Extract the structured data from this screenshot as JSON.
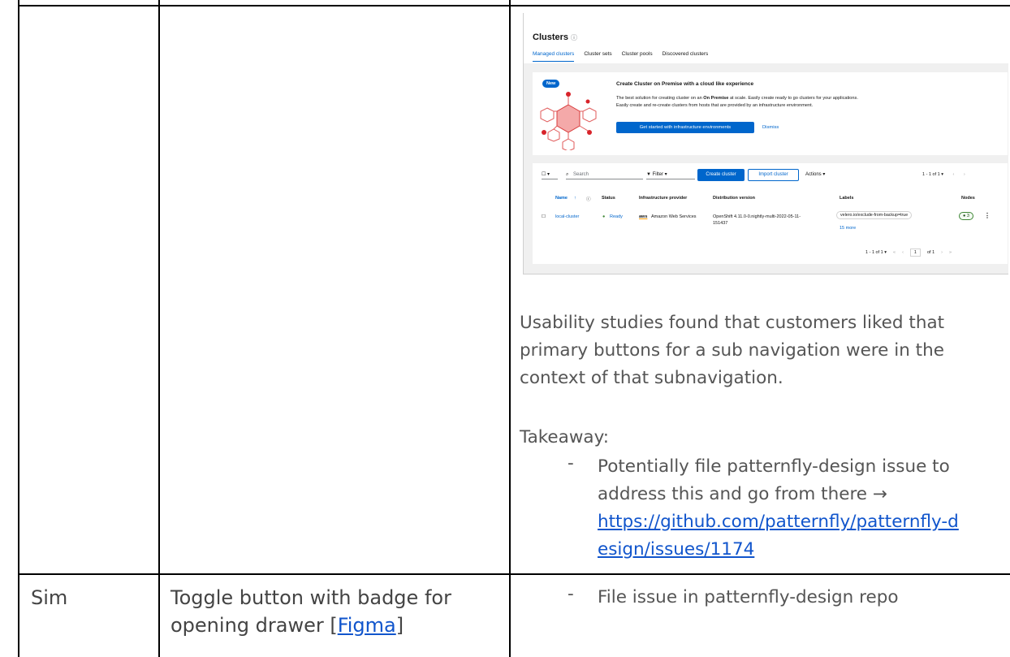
{
  "screenshot": {
    "title": "Clusters",
    "help_icon": "help-circle-icon",
    "tabs": [
      "Managed clusters",
      "Cluster sets",
      "Cluster pools",
      "Discovered clusters"
    ],
    "active_tab": "Managed clusters",
    "banner": {
      "badge": "New",
      "title": "Create Cluster on Premise with a cloud like experience",
      "desc_1": "The best solution for creating cluster on an",
      "desc_bold": "On Premise",
      "desc_2": "at scale. Easily create ready to go clusters for your applications.",
      "desc_3": "Easily create and re-create clusters from hosts that are provided by an infrastructure environment.",
      "button": "Get started with infrastructure environments",
      "dismiss": "Dismiss"
    },
    "toolbar": {
      "search_placeholder": "Search",
      "filter": "Filter",
      "create": "Create cluster",
      "import": "Import cluster",
      "actions": "Actions",
      "pagination": "1 - 1 of 1"
    },
    "columns": [
      "Name",
      "Status",
      "Infrastructure provider",
      "Distribution version",
      "Labels",
      "Nodes"
    ],
    "row": {
      "name": "local-cluster",
      "status": "Ready",
      "provider_logo": "aws",
      "provider": "Amazon Web Services",
      "version_line1": "OpenShift 4.11.0-0.nightly-multi-2022-05-11-",
      "version_line2": "151437",
      "label": "velero.io/exclude-from-backup=true",
      "more": "15 more",
      "nodes": "3"
    },
    "bottom_pagination": {
      "range": "1 - 1 of 1",
      "page": "1",
      "of": "of 1"
    }
  },
  "document": {
    "finding_line1": "Usability studies found that customers liked that",
    "finding_line2": "primary buttons for a sub navigation were in the",
    "finding_line3": "context of that subnavigation.",
    "takeaway_label": "Takeaway:",
    "takeaway_line1": "Potentially file patternfly-design issue to",
    "takeaway_line2": "address this and go from there →",
    "issue_link_line1": "https://github.com/patternfly/patternfly-d",
    "issue_link_line2": "esign/issues/1174",
    "dash": "-",
    "row2_owner": "Sim",
    "row2_item_text": "Toggle button with badge for",
    "row2_item_text2_pre": "opening drawer [",
    "row2_item_link": "Figma",
    "row2_item_text2_post": "]",
    "row2_action": "File issue in patternfly-design repo"
  }
}
